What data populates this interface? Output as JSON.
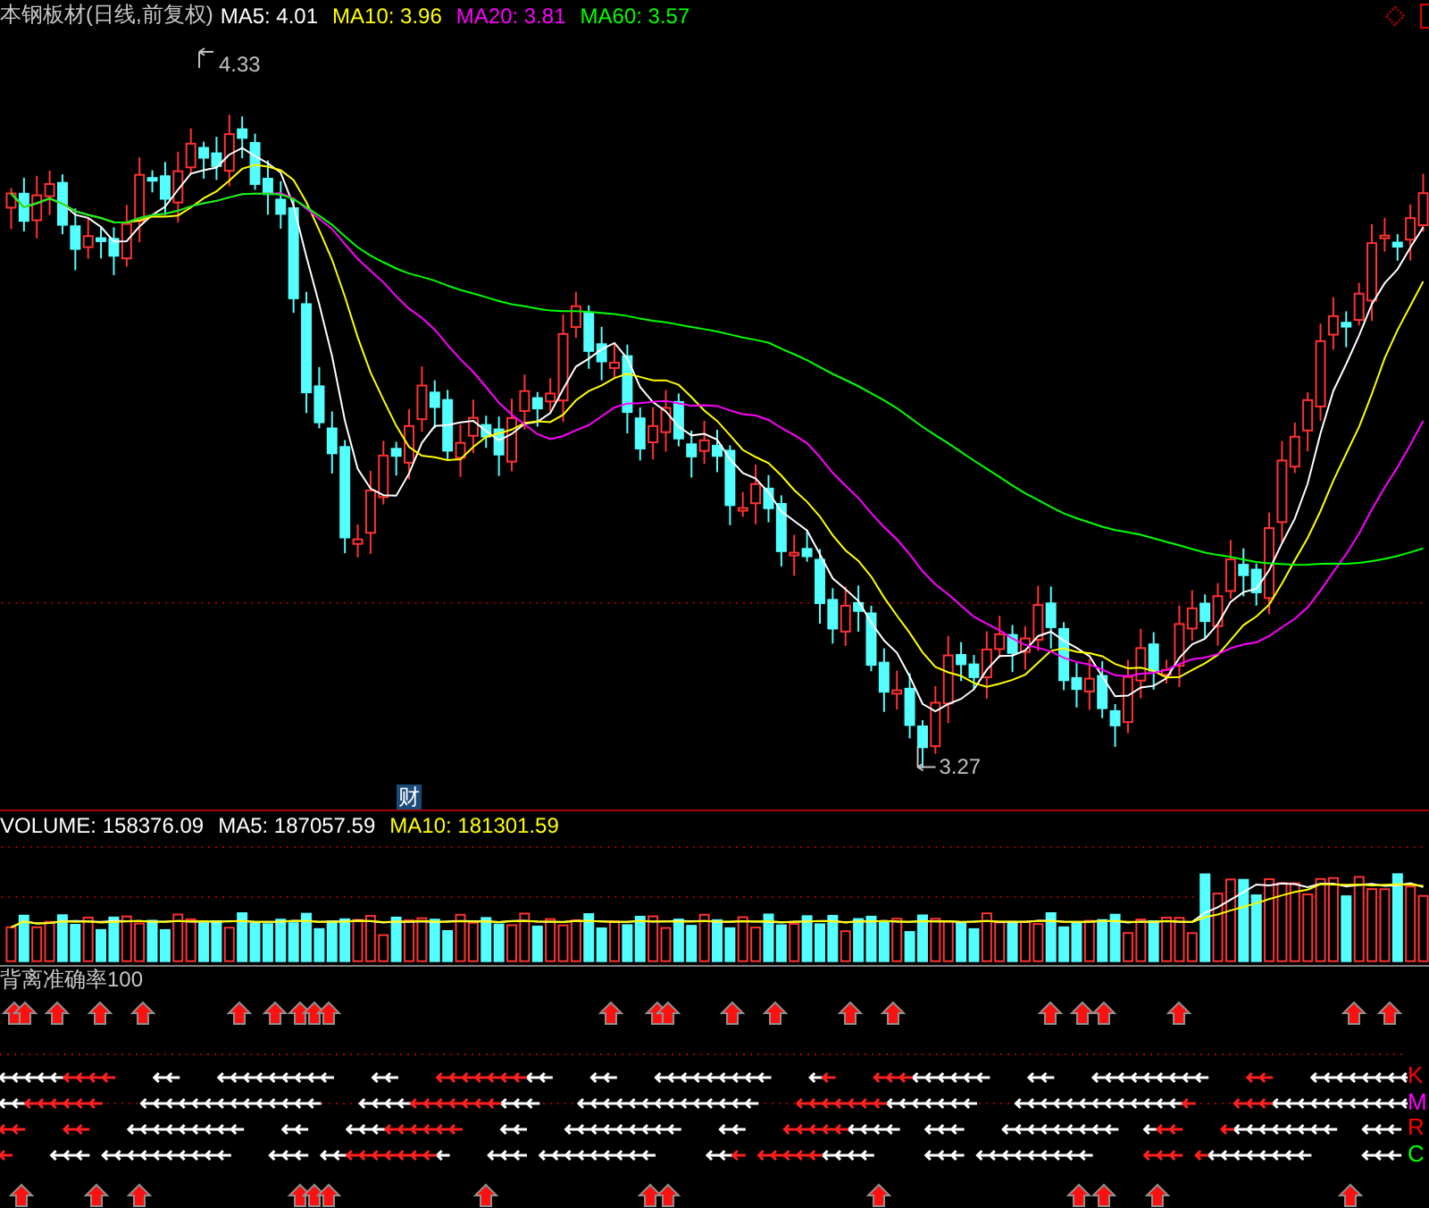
{
  "header": {
    "title": "本钢板材(日线,前复权)",
    "indicators": [
      {
        "label": "MA5: 4.01",
        "color": "#ffffff"
      },
      {
        "label": "MA10: 3.96",
        "color": "#ffff00"
      },
      {
        "label": "MA20: 3.81",
        "color": "#ff00ff"
      },
      {
        "label": "MA60: 3.57",
        "color": "#00ff00"
      }
    ]
  },
  "price_chart": {
    "high_label": "4.33",
    "low_label": "3.27",
    "badge": "财"
  },
  "volume": {
    "indicators": [
      {
        "label": "VOLUME: 158376.09",
        "color": "#ffffff"
      },
      {
        "label": "MA5: 187057.59",
        "color": "#ffffff"
      },
      {
        "label": "MA10: 181301.59",
        "color": "#ffff00"
      }
    ]
  },
  "signal_panel": {
    "title": "背离准确率100",
    "rows": [
      {
        "label": "K",
        "color": "#ff0000"
      },
      {
        "label": "M",
        "color": "#ff00ff"
      },
      {
        "label": "R",
        "color": "#ff0000"
      },
      {
        "label": "C",
        "color": "#00ff00"
      }
    ]
  }
}
